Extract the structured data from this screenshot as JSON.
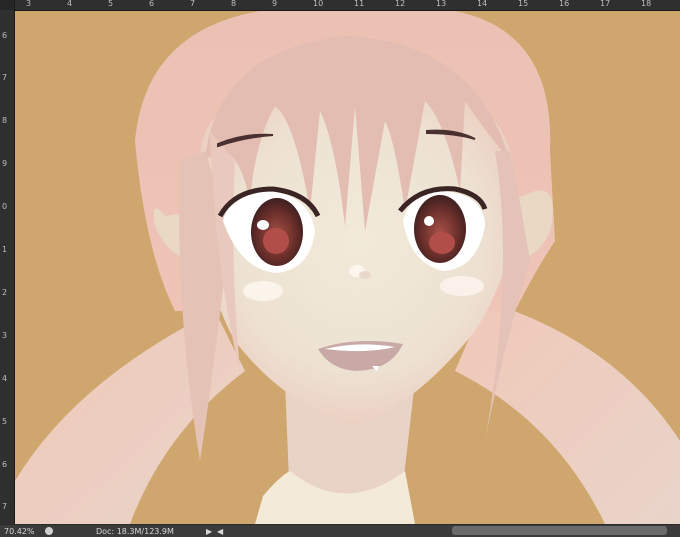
{
  "ruler_top": {
    "labels": [
      "3",
      "4",
      "5",
      "6",
      "7",
      "8",
      "9",
      "10",
      "11",
      "12",
      "13",
      "14",
      "15",
      "16",
      "17",
      "18"
    ]
  },
  "ruler_left": {
    "labels": [
      "6",
      "7",
      "8",
      "9",
      "0",
      "1",
      "2",
      "3",
      "4",
      "5",
      "6",
      "7"
    ]
  },
  "statusbar": {
    "zoom": "70.42%",
    "doc_info": "Doc: 18.3M/123.9M",
    "arrow_right": "▶",
    "arrow_left": "◀"
  },
  "colors": {
    "background": "#cea66e",
    "hair": "#efc0b4",
    "skin": "#ede3d5",
    "eye_iris": "#5a2d2a"
  }
}
